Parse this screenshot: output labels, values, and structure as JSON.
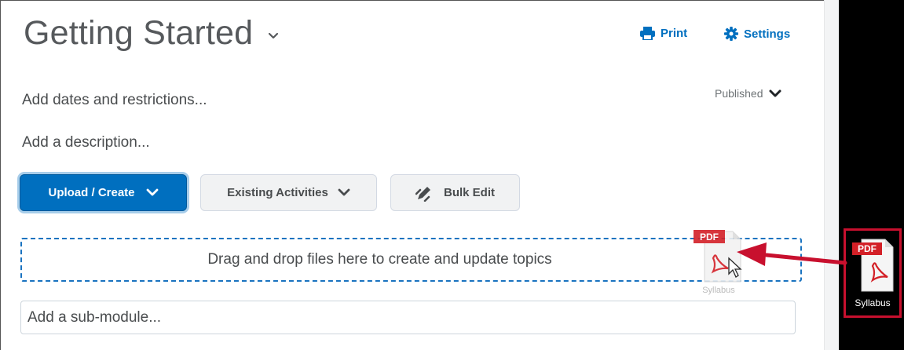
{
  "header": {
    "title": "Getting Started",
    "print_label": "Print",
    "settings_label": "Settings",
    "status_label": "Published"
  },
  "module": {
    "dates_text": "Add dates and restrictions...",
    "description_text": "Add a description..."
  },
  "toolbar": {
    "upload_create_label": "Upload / Create",
    "existing_activities_label": "Existing Activities",
    "bulk_edit_label": "Bulk Edit"
  },
  "dropzone": {
    "text": "Drag and drop files here to create and update topics",
    "dragged_file_label": "Syllabus"
  },
  "submodule": {
    "placeholder": "Add a sub-module..."
  },
  "desktop": {
    "file_label": "Syllabus",
    "file_badge": "PDF"
  },
  "colors": {
    "accent": "#006fbf",
    "highlight_red": "#c8102e",
    "pdf_red": "#d32027"
  },
  "icons": {
    "title_dropdown": "chevron-down-icon",
    "print": "printer-icon",
    "settings": "gear-icon",
    "bulk_edit": "pencil-icon",
    "file": "pdf-file-icon",
    "pointer": "mouse-cursor-icon",
    "arrow": "red-arrow-icon"
  }
}
